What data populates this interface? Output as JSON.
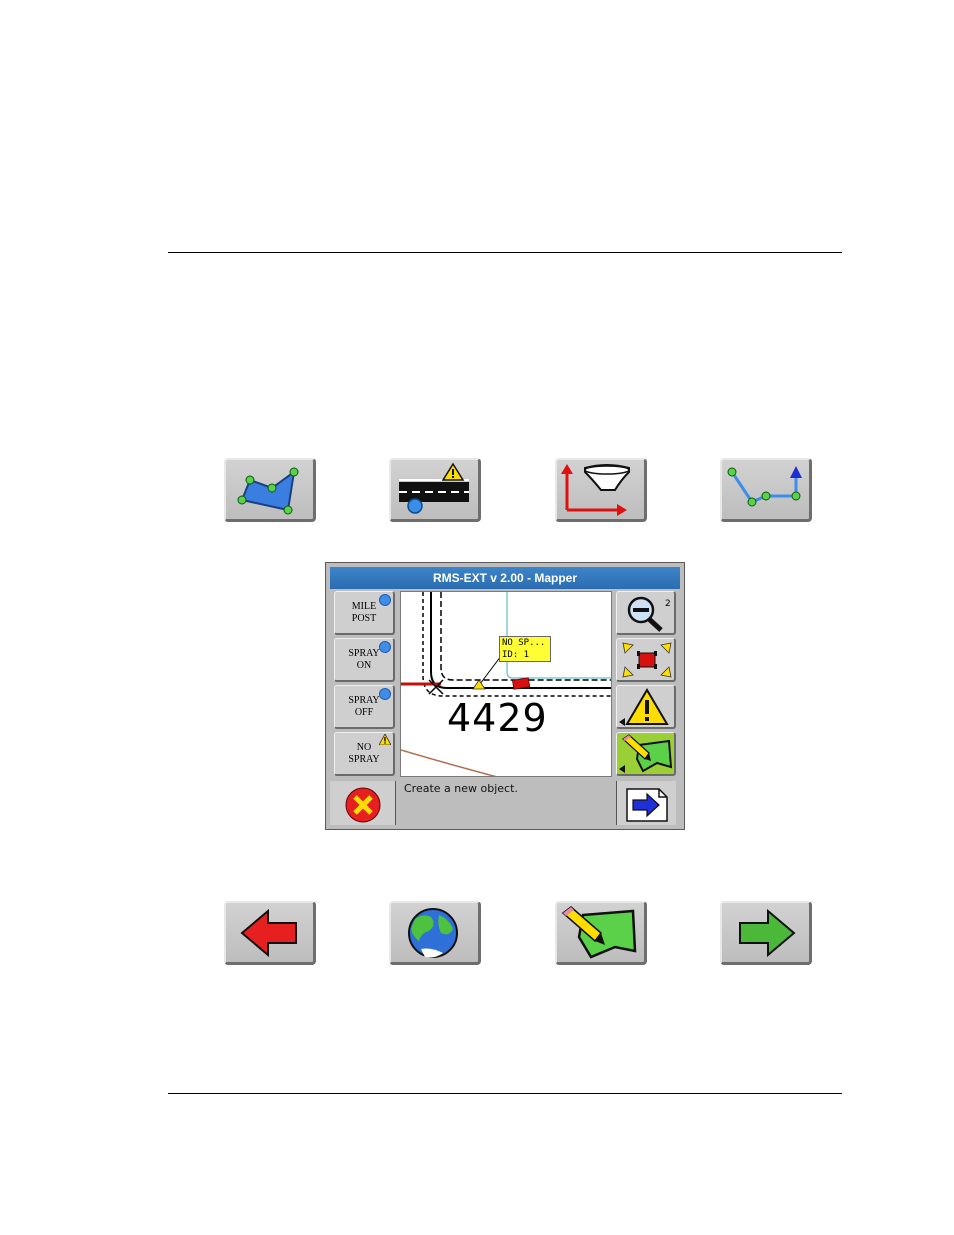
{
  "top_toolbar": {
    "icons": [
      "area-polygon-icon",
      "road-hazard-icon",
      "gps-antenna-offset-icon",
      "line-path-icon"
    ]
  },
  "screen": {
    "title": "RMS-EXT v 2.00 - Mapper",
    "side_buttons": [
      {
        "line1": "MILE",
        "line2": "POST",
        "indicator": "blue-dot-icon"
      },
      {
        "line1": "SPRAY",
        "line2": "ON",
        "indicator": "blue-dot-icon"
      },
      {
        "line1": "SPRAY",
        "line2": "OFF",
        "indicator": "blue-dot-icon"
      },
      {
        "line1": "NO",
        "line2": "SPRAY",
        "indicator": "warning-icon"
      }
    ],
    "map": {
      "tag_line1": "NO SP...",
      "tag_line2": "ID: 1",
      "number": "4429"
    },
    "zoom_level": "2",
    "status": "Create a new object.",
    "colors": {
      "title_bar": "#2b6db0",
      "active_button": "#9ad036",
      "indicator": "#3e8ee8"
    }
  },
  "bottom_toolbar": {
    "icons": [
      "back-arrow-icon",
      "globe-icon",
      "edit-area-icon",
      "forward-arrow-icon"
    ]
  }
}
